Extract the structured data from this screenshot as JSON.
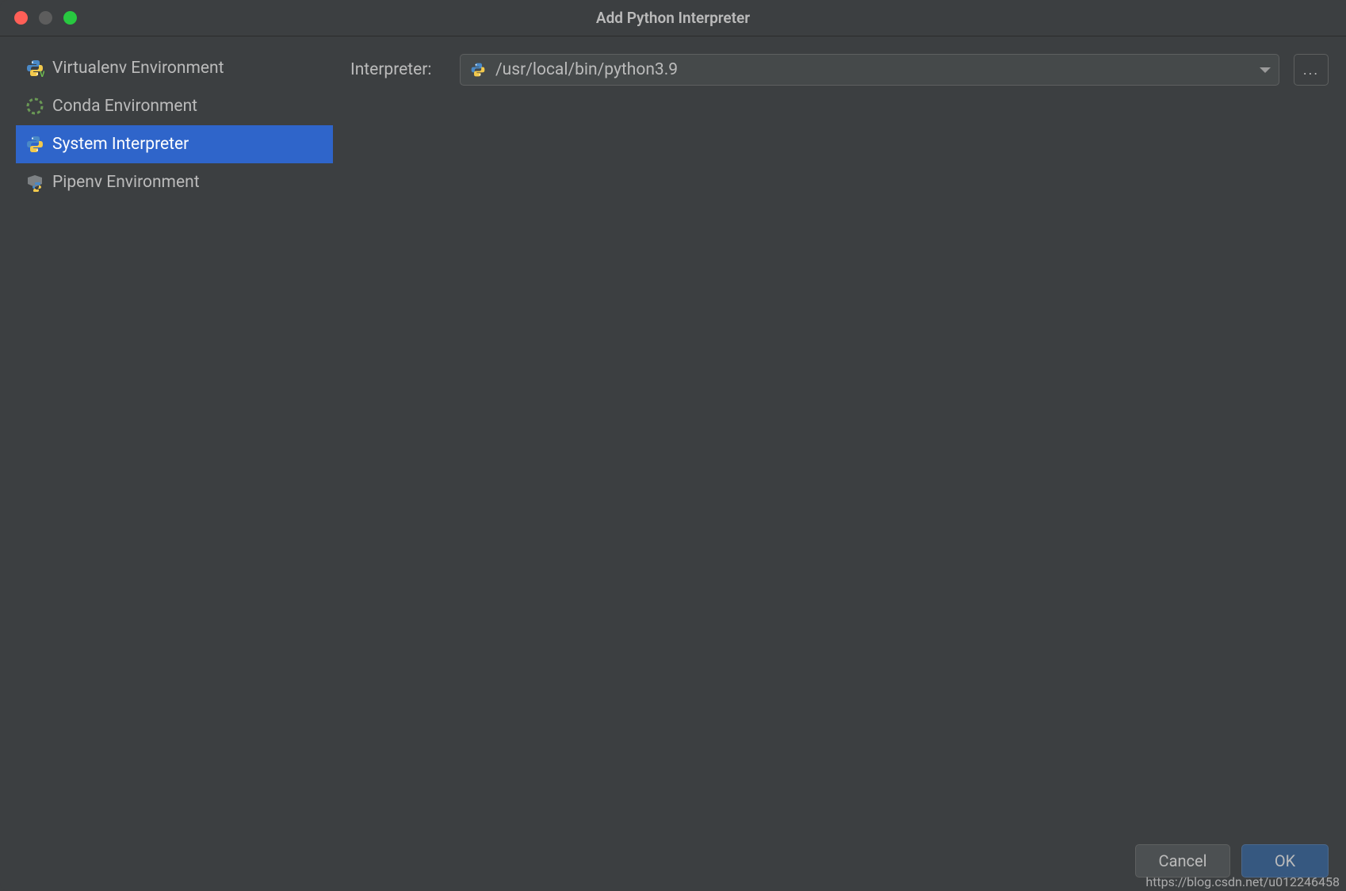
{
  "window": {
    "title": "Add Python Interpreter"
  },
  "sidebar": {
    "items": [
      {
        "label": "Virtualenv Environment",
        "icon": "python-venv-icon",
        "selected": false
      },
      {
        "label": "Conda Environment",
        "icon": "conda-icon",
        "selected": false
      },
      {
        "label": "System Interpreter",
        "icon": "python-icon",
        "selected": true
      },
      {
        "label": "Pipenv Environment",
        "icon": "pipenv-icon",
        "selected": false
      }
    ]
  },
  "form": {
    "interpreter_label": "Interpreter:",
    "interpreter_value": "/usr/local/bin/python3.9",
    "browse_label": "..."
  },
  "footer": {
    "cancel_label": "Cancel",
    "ok_label": "OK"
  },
  "watermark": "https://blog.csdn.net/u012246458"
}
